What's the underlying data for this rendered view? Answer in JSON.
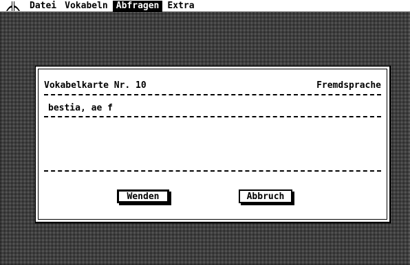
{
  "menubar": {
    "logo_icon": "atari-fuji-icon",
    "items": [
      {
        "label": "Datei",
        "active": false
      },
      {
        "label": "Vokabeln",
        "active": false
      },
      {
        "label": "Abfragen",
        "active": true
      },
      {
        "label": "Extra",
        "active": false
      }
    ]
  },
  "dialog": {
    "title": "Vokabelkarte Nr. 10",
    "language": "Fremdsprache",
    "word": "bestia, ae f",
    "answer": "",
    "buttons": {
      "turn": "Wenden",
      "cancel": "Abbruch"
    }
  },
  "colors": {
    "foreground": "#000000",
    "background": "#ffffff"
  }
}
